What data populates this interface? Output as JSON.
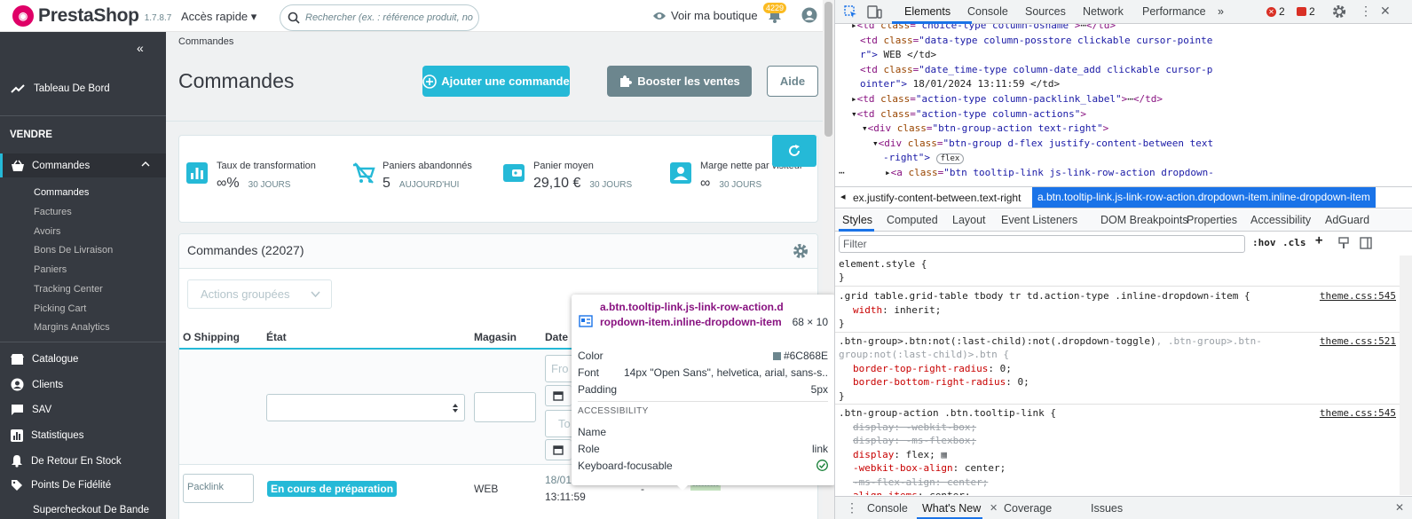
{
  "app": {
    "brand": "PrestaShop",
    "version": "1.7.8.7",
    "quick_access": "Accès rapide",
    "search_placeholder": "Rechercher (ex. : référence produit, no",
    "view_shop": "Voir ma boutique",
    "notif_count": "4229"
  },
  "sidebar": {
    "dashboard": "Tableau De Bord",
    "section": "VENDRE",
    "orders": "Commandes",
    "sub_items": [
      "Commandes",
      "Factures",
      "Avoirs",
      "Bons De Livraison",
      "Paniers",
      "Tracking Center",
      "Picking Cart",
      "Margins Analytics"
    ],
    "main_items": [
      "Catalogue",
      "Clients",
      "SAV",
      "Statistiques",
      "De Retour En Stock",
      "Points De Fidélité",
      "Supercheckout De Bande"
    ]
  },
  "page": {
    "breadcrumb": "Commandes",
    "title": "Commandes",
    "add_order": "Ajouter une commande",
    "boost": "Booster les ventes",
    "help": "Aide"
  },
  "kpis": [
    {
      "label": "Taux de transformation",
      "value": "∞%",
      "period": "30 JOURS"
    },
    {
      "label": "Paniers abandonnés",
      "value": "5",
      "period": "AUJOURD'HUI"
    },
    {
      "label": "Panier moyen",
      "value": "29,10 €",
      "period": "30 JOURS"
    },
    {
      "label": "Marge nette par visiteur",
      "value": "∞",
      "period": "30 JOURS"
    }
  ],
  "orders": {
    "title": "Commandes (22027)",
    "bulk": "Actions groupées",
    "columns": [
      "O Shipping",
      "État",
      "Magasin",
      "Date"
    ],
    "filter_from": "Fro",
    "filter_to": "To",
    "row": {
      "shipping": "Packlink",
      "status": "En cours de préparation",
      "store": "WEB",
      "date1": "18/01/2024",
      "date2": "13:11:59",
      "dash": "-",
      "dashes": "---------"
    }
  },
  "tooltip": {
    "selector": "a.btn.tooltip-link.js-link-row-action.dropdown-item.inline-dropdown-item",
    "size": "68 × 10",
    "rows": [
      {
        "k": "Color",
        "v": "#6C868E"
      },
      {
        "k": "Font",
        "v": "14px \"Open Sans\", helvetica, arial, sans-s..."
      },
      {
        "k": "Padding",
        "v": "5px"
      }
    ],
    "acc_title": "ACCESSIBILITY",
    "acc_rows": [
      {
        "k": "Name",
        "v": ""
      },
      {
        "k": "Role",
        "v": "link"
      },
      {
        "k": "Keyboard-focusable",
        "v": ""
      }
    ],
    "color_swatch": "#6C868E"
  },
  "devtools": {
    "tabs": [
      "Elements",
      "Console",
      "Sources",
      "Network",
      "Performance"
    ],
    "errors": "2",
    "warnings": "2",
    "breadcrumb_1": "ex.justify-content-between.text-right",
    "breadcrumb_2": "a.btn.tooltip-link.js-link-row-action.dropdown-item.inline-dropdown-item",
    "style_tabs": [
      "Styles",
      "Computed",
      "Layout",
      "Event Listeners",
      "DOM Breakpoints",
      "Properties",
      "Accessibility",
      "AdGuard"
    ],
    "filter_placeholder": "Filter",
    "hov": ":hov",
    "cls": ".cls",
    "drawer_tabs": [
      "Console",
      "What's New",
      "Coverage",
      "Issues"
    ],
    "dom": {
      "l0_class": "choice-type column-osname",
      "l1_class": "data-type column-posstore clickable cursor-pointe",
      "l1b": "r\">",
      "l1_text": " WEB </td>",
      "l2_class": "date_time-type column-date_add clickable cursor-p",
      "l2b": "ointer\">",
      "l2_text": " 18/01/2024 13:11:59 </td>",
      "l3_class": "action-type column-packlink_label",
      "l4_class": "action-type column-actions",
      "l5_class": "btn-group-action text-right",
      "l6_class": "btn-group d-flex justify-content-between text",
      "l6b": "-right\">",
      "flex": "flex",
      "l7_class": "btn tooltip-link js-link-row-action dropdown-"
    },
    "rules": {
      "r0": "element.style {",
      "r1_sel": ".grid table.grid-table tbody tr td.action-type .inline-dropdown-item {",
      "r1_src": "theme.css:545",
      "r1_p": "width",
      "r1_v": "inherit",
      "r2_sel": ".btn-group>.btn:not(:last-child):not(.dropdown-toggle)",
      "r2_sel2": ", .btn-group>.btn-",
      "r2_sel3": "group:not(:last-child)>.btn {",
      "r2_src": "theme.css:521",
      "r2_p1": "border-top-right-radius",
      "r2_v1": "0",
      "r2_p2": "border-bottom-right-radius",
      "r2_v2": "0",
      "r3_sel": ".btn-group-action .btn.tooltip-link {",
      "r3_src": "theme.css:545",
      "r3_l1": "display: -webkit-box;",
      "r3_l2": "display: -ms-flexbox;",
      "r3_p3": "display",
      "r3_v3": "flex",
      "r3_p4": "-webkit-box-align",
      "r3_v4": "center",
      "r3_l5": "-ms-flex-align: center;",
      "r3_p6": "align-items",
      "r3_v6": "center",
      "close": "}"
    }
  },
  "colors": {
    "accent": "#25b9d7",
    "sidebar": "#363a41",
    "grey_btn": "#6c868e",
    "brand": "#df0067"
  }
}
